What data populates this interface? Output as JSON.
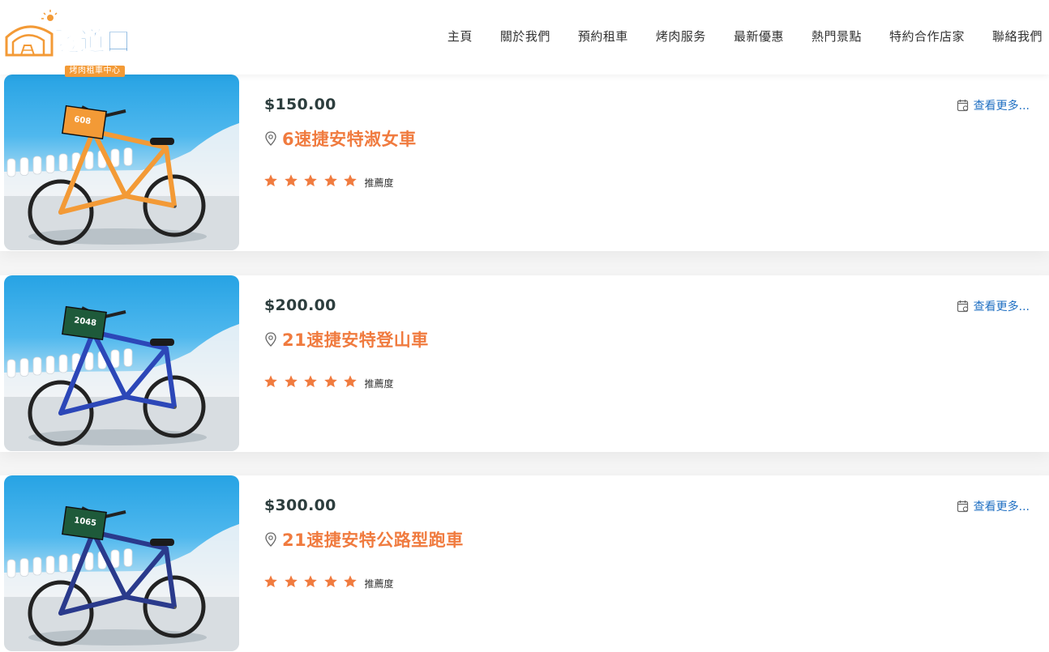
{
  "header": {
    "logo_main": "隧道口",
    "logo_sub": "烤肉租車中心",
    "nav": [
      {
        "label": "主頁"
      },
      {
        "label": "關於我們"
      },
      {
        "label": "預約租車"
      },
      {
        "label": "烤肉服务"
      },
      {
        "label": "最新優惠"
      },
      {
        "label": "熱門景點"
      },
      {
        "label": "特約合作店家"
      },
      {
        "label": "聯絡我們"
      }
    ]
  },
  "colors": {
    "accent": "#f07b3f",
    "link": "#1f6fc2",
    "price": "#2d3e3e",
    "logo_blue": "#2c7cc6",
    "logo_orange": "#f39a36"
  },
  "listings": [
    {
      "price": "$150.00",
      "title": "6速捷安特淑女車",
      "rating": 5,
      "rating_label": "推薦度",
      "more_label": "查看更多...",
      "plate": "608",
      "bike_color": "#f39a36"
    },
    {
      "price": "$200.00",
      "title": "21速捷安特登山車",
      "rating": 5,
      "rating_label": "推薦度",
      "more_label": "查看更多...",
      "plate": "2048",
      "bike_color": "#2c47b8"
    },
    {
      "price": "$300.00",
      "title": "21速捷安特公路型跑車",
      "rating": 5,
      "rating_label": "推薦度",
      "more_label": "查看更多...",
      "plate": "1065",
      "bike_color": "#2a3a8c"
    }
  ]
}
